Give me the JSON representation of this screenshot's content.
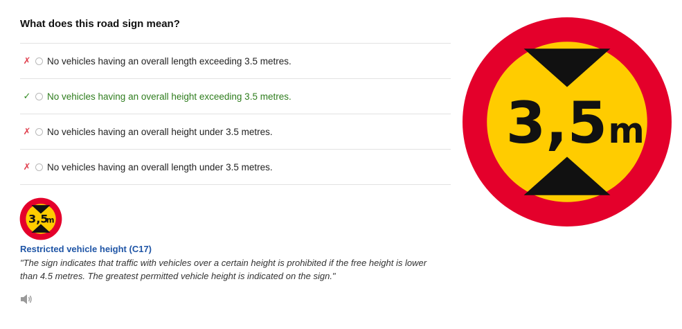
{
  "question": "What does this road sign mean?",
  "answers": [
    {
      "mark": "✗",
      "text": "No vehicles having an overall length exceeding 3.5 metres."
    },
    {
      "mark": "✓",
      "text": "No vehicles having an overall height exceeding 3.5 metres."
    },
    {
      "mark": "✗",
      "text": "No vehicles having an overall height under 3.5 metres."
    },
    {
      "mark": "✗",
      "text": "No vehicles having an overall length under 3.5 metres."
    }
  ],
  "sign": {
    "value": "3,5",
    "unit": "m",
    "title": "Restricted vehicle height (C17)",
    "description": "\"The sign indicates that traffic with vehicles over a certain height is prohibited if the free height is lower than 4.5 metres. The greatest permitted vehicle height is indicated on the sign.\"",
    "colors": {
      "ring": "#e4002b",
      "fill": "#ffcc00",
      "marks": "#111111"
    }
  },
  "icons": {
    "audio": "speaker-icon",
    "correct": "check-icon",
    "wrong": "cross-icon"
  }
}
